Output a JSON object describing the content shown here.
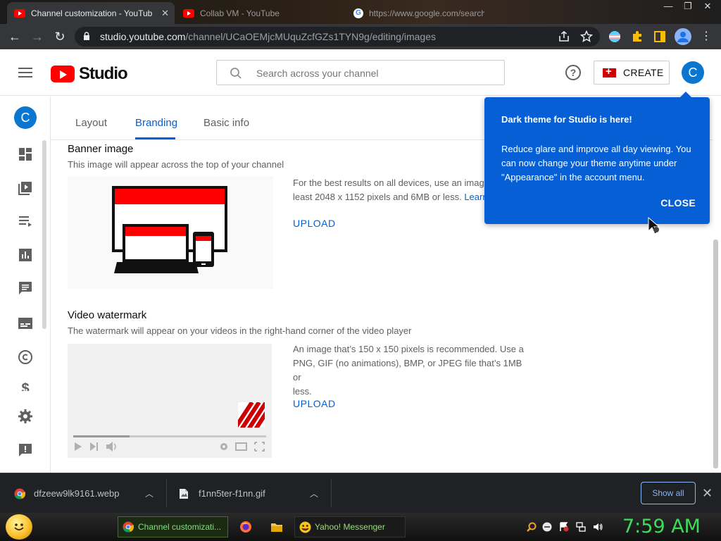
{
  "browser": {
    "tabs": [
      {
        "title": "Channel customization - YouTube",
        "favicon": "youtube-icon",
        "active": true
      },
      {
        "title": "Collab VM - YouTube",
        "favicon": "youtube-icon",
        "active": false
      },
      {
        "title": "https://www.google.com/search",
        "favicon": "google-icon",
        "active": false
      }
    ],
    "url_host": "studio.youtube.com",
    "url_path": "/channel/UCaOEMjcMUquZcfGZs1TYN9g/editing/images"
  },
  "studio": {
    "logo_text": "Studio",
    "search_placeholder": "Search across your channel",
    "create_label": "CREATE",
    "avatar_letter": "C"
  },
  "page_tabs": [
    {
      "label": "Layout",
      "active": false
    },
    {
      "label": "Branding",
      "active": true
    },
    {
      "label": "Basic info",
      "active": false
    }
  ],
  "banner": {
    "title": "Banner image",
    "description": "This image will appear across the top of your channel",
    "info_line1": "For the best results on all devices, use an image",
    "info_line2": "least 2048 x 1152 pixels and 6MB or less.",
    "learn_more": "Learn",
    "upload_label": "UPLOAD"
  },
  "watermark": {
    "title": "Video watermark",
    "description": "The watermark will appear on your videos in the right-hand corner of the video player",
    "info_line1": "An image that’s 150 x 150 pixels is recommended. Use a",
    "info_line2": "PNG, GIF (no animations), BMP, or JPEG file that’s 1MB or",
    "info_line3": "less.",
    "upload_label": "UPLOAD"
  },
  "popup": {
    "title": "Dark theme for Studio is here!",
    "body": "Reduce glare and improve all day viewing. You can now change your theme anytime under \"Appearance\" in the account menu.",
    "close_label": "CLOSE"
  },
  "downloads": {
    "items": [
      {
        "filename": "dfzeew9lk9161.webp",
        "icon": "chrome-file-icon"
      },
      {
        "filename": "f1nn5ter-f1nn.gif",
        "icon": "image-file-icon"
      }
    ],
    "show_all_label": "Show all"
  },
  "taskbar": {
    "buttons": [
      {
        "label": "Channel customizati...",
        "icon": "chrome-icon"
      },
      {
        "label": "Yahoo! Messenger",
        "icon": "yahoo-messenger-icon"
      }
    ],
    "clock": "7:59 AM"
  },
  "colors": {
    "accent_blue": "#065fd4",
    "youtube_red": "#ff0000",
    "clock_green": "#3ddc5a"
  }
}
